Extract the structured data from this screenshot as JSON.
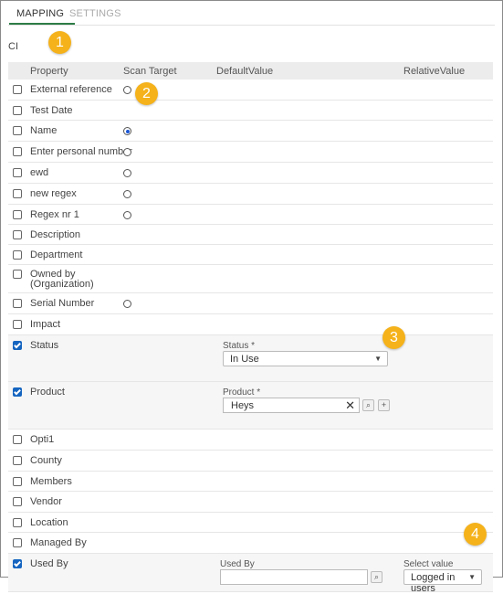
{
  "tabs": {
    "mapping": "MAPPING",
    "settings": "SETTINGS"
  },
  "section_title": "CI",
  "columns": {
    "property": "Property",
    "scan_target": "Scan Target",
    "default_value": "DefaultValue",
    "relative_value": "RelativeValue"
  },
  "rows": [
    {
      "label": "External reference",
      "checked": false,
      "radio": "off"
    },
    {
      "label": "Test Date",
      "checked": false,
      "radio": "none"
    },
    {
      "label": "Name",
      "checked": false,
      "radio": "on"
    },
    {
      "label": "Enter personal number",
      "checked": false,
      "radio": "off"
    },
    {
      "label": "ewd",
      "checked": false,
      "radio": "off"
    },
    {
      "label": "new regex",
      "checked": false,
      "radio": "off"
    },
    {
      "label": "Regex nr 1",
      "checked": false,
      "radio": "off"
    },
    {
      "label": "Description",
      "checked": false,
      "radio": "none"
    },
    {
      "label": "Department",
      "checked": false,
      "radio": "none"
    },
    {
      "label": "Owned by",
      "label2": "(Organization)",
      "checked": false,
      "radio": "none"
    },
    {
      "label": "Serial Number",
      "checked": false,
      "radio": "off"
    },
    {
      "label": "Impact",
      "checked": false,
      "radio": "none"
    },
    {
      "label": "Status",
      "checked": true,
      "radio": "none"
    },
    {
      "label": "Product",
      "checked": true,
      "radio": "none"
    },
    {
      "label": "Opti1",
      "checked": false,
      "radio": "none"
    },
    {
      "label": "County",
      "checked": false,
      "radio": "none"
    },
    {
      "label": "Members",
      "checked": false,
      "radio": "none"
    },
    {
      "label": "Vendor",
      "checked": false,
      "radio": "none"
    },
    {
      "label": "Location",
      "checked": false,
      "radio": "none"
    },
    {
      "label": "Managed By",
      "checked": false,
      "radio": "none"
    },
    {
      "label": "Used By",
      "checked": true,
      "radio": "none"
    }
  ],
  "status_field": {
    "label": "Status *",
    "value": "In Use"
  },
  "product_field": {
    "label": "Product *",
    "value": "Heys",
    "clear_icon": "close-icon"
  },
  "used_by_field": {
    "label": "Used By",
    "value": ""
  },
  "select_value_field": {
    "label": "Select value",
    "value": "Logged in users"
  },
  "badges": [
    "1",
    "2",
    "3",
    "4"
  ],
  "colors": {
    "accent_tab": "#2e7d46",
    "checkbox": "#1565c0",
    "badge": "#f5b21a"
  }
}
